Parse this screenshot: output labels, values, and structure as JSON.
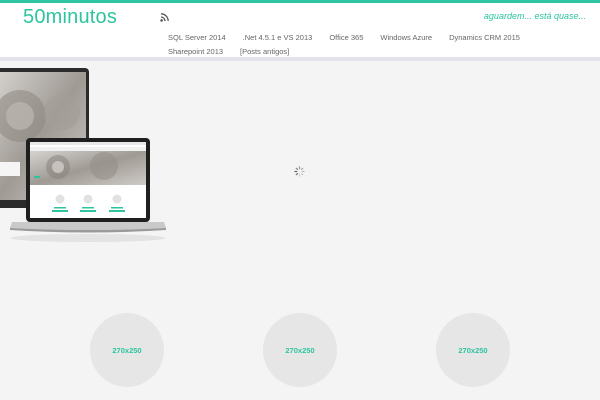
{
  "header": {
    "logo": "50minutos",
    "tagline": "aguardem... está quase...",
    "nav": {
      "row1": [
        "SQL Server 2014",
        ".Net 4.5.1 e VS 2013",
        "Office 365",
        "Windows Azure",
        "Dynamics CRM 2015"
      ],
      "row2": [
        "Sharepoint 2013",
        "[Posts antigos]"
      ]
    }
  },
  "thumbnails": [
    "270x250",
    "270x250",
    "270x250"
  ],
  "colors": {
    "accent": "#2ec4a0",
    "page_bg": "#f4f4f4",
    "header_bg": "#ffffff"
  },
  "icons": [
    "rss-icon",
    "loading-spinner-icon"
  ]
}
